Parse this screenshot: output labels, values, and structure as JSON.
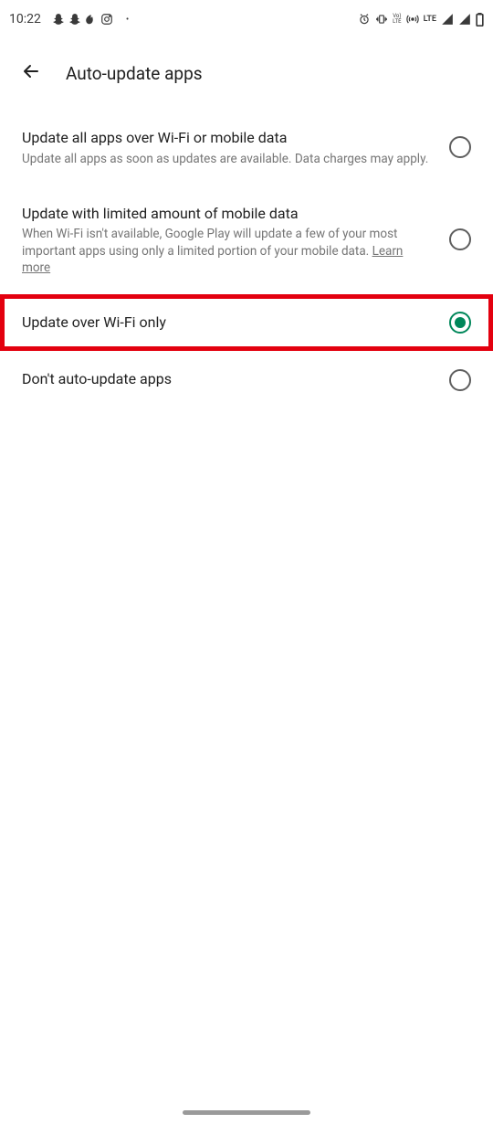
{
  "status": {
    "time": "10:22",
    "lte": "LTE",
    "vo": "Vo)",
    "lte_small": "LTE"
  },
  "header": {
    "title": "Auto-update apps"
  },
  "options": [
    {
      "title": "Update all apps over Wi-Fi or mobile data",
      "subtitle": "Update all apps as soon as updates are available. Data charges may apply.",
      "checked": false,
      "highlighted": false
    },
    {
      "title": "Update with limited amount of mobile data",
      "subtitle_prefix": "When Wi-Fi isn't available, Google Play will update a few of your most important apps using only a limited portion of your mobile data. ",
      "learn_more": "Learn more",
      "checked": false,
      "highlighted": false
    },
    {
      "title": "Update over Wi-Fi only",
      "subtitle": "",
      "checked": true,
      "highlighted": true
    },
    {
      "title": "Don't auto-update apps",
      "subtitle": "",
      "checked": false,
      "highlighted": false
    }
  ]
}
